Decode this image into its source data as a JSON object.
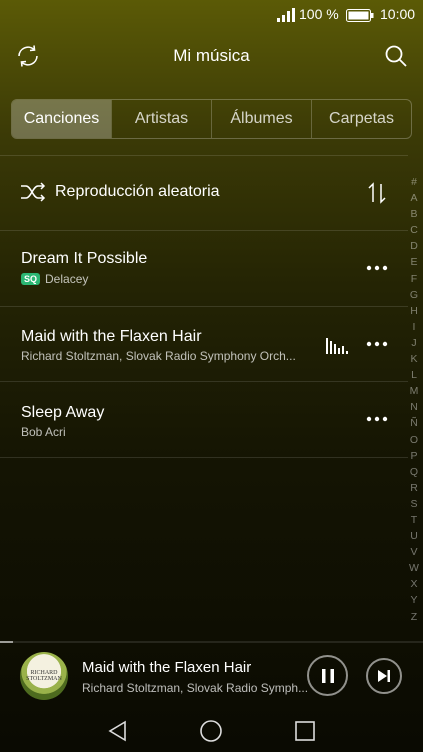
{
  "status": {
    "battery_percent": "100 %",
    "time": "10:00"
  },
  "header": {
    "title": "Mi música",
    "refresh_icon": "refresh-icon",
    "search_icon": "search-icon"
  },
  "tabs": [
    {
      "label": "Canciones",
      "active": true
    },
    {
      "label": "Artistas",
      "active": false
    },
    {
      "label": "Álbumes",
      "active": false
    },
    {
      "label": "Carpetas",
      "active": false
    }
  ],
  "shuffle": {
    "label": "Reproducción aleatoria",
    "icon": "shuffle-icon",
    "sort_icon": "sort-icon"
  },
  "songs": [
    {
      "title": "Dream It Possible",
      "badge": "SQ",
      "artist": "Delacey",
      "playing": false
    },
    {
      "title": "Maid with the Flaxen Hair",
      "badge": "",
      "artist": "Richard Stoltzman, Slovak Radio Symphony Orch...",
      "playing": true
    },
    {
      "title": "Sleep Away",
      "badge": "",
      "artist": "Bob Acri",
      "playing": false
    }
  ],
  "index_letters": [
    "#",
    "A",
    "B",
    "C",
    "D",
    "E",
    "F",
    "G",
    "H",
    "I",
    "J",
    "K",
    "L",
    "M",
    "N",
    "Ñ",
    "O",
    "P",
    "Q",
    "R",
    "S",
    "T",
    "U",
    "V",
    "W",
    "X",
    "Y",
    "Z"
  ],
  "now_playing": {
    "title": "Maid with the Flaxen Hair",
    "artist": "Richard Stoltzman, Slovak Radio Symph...",
    "art_text": "RICHARD STOLTZMAN",
    "progress": 0.03
  },
  "colors": {
    "accent_green": "#2bb673",
    "background_top": "#5b5a06",
    "background_bottom": "#0a0a02"
  }
}
